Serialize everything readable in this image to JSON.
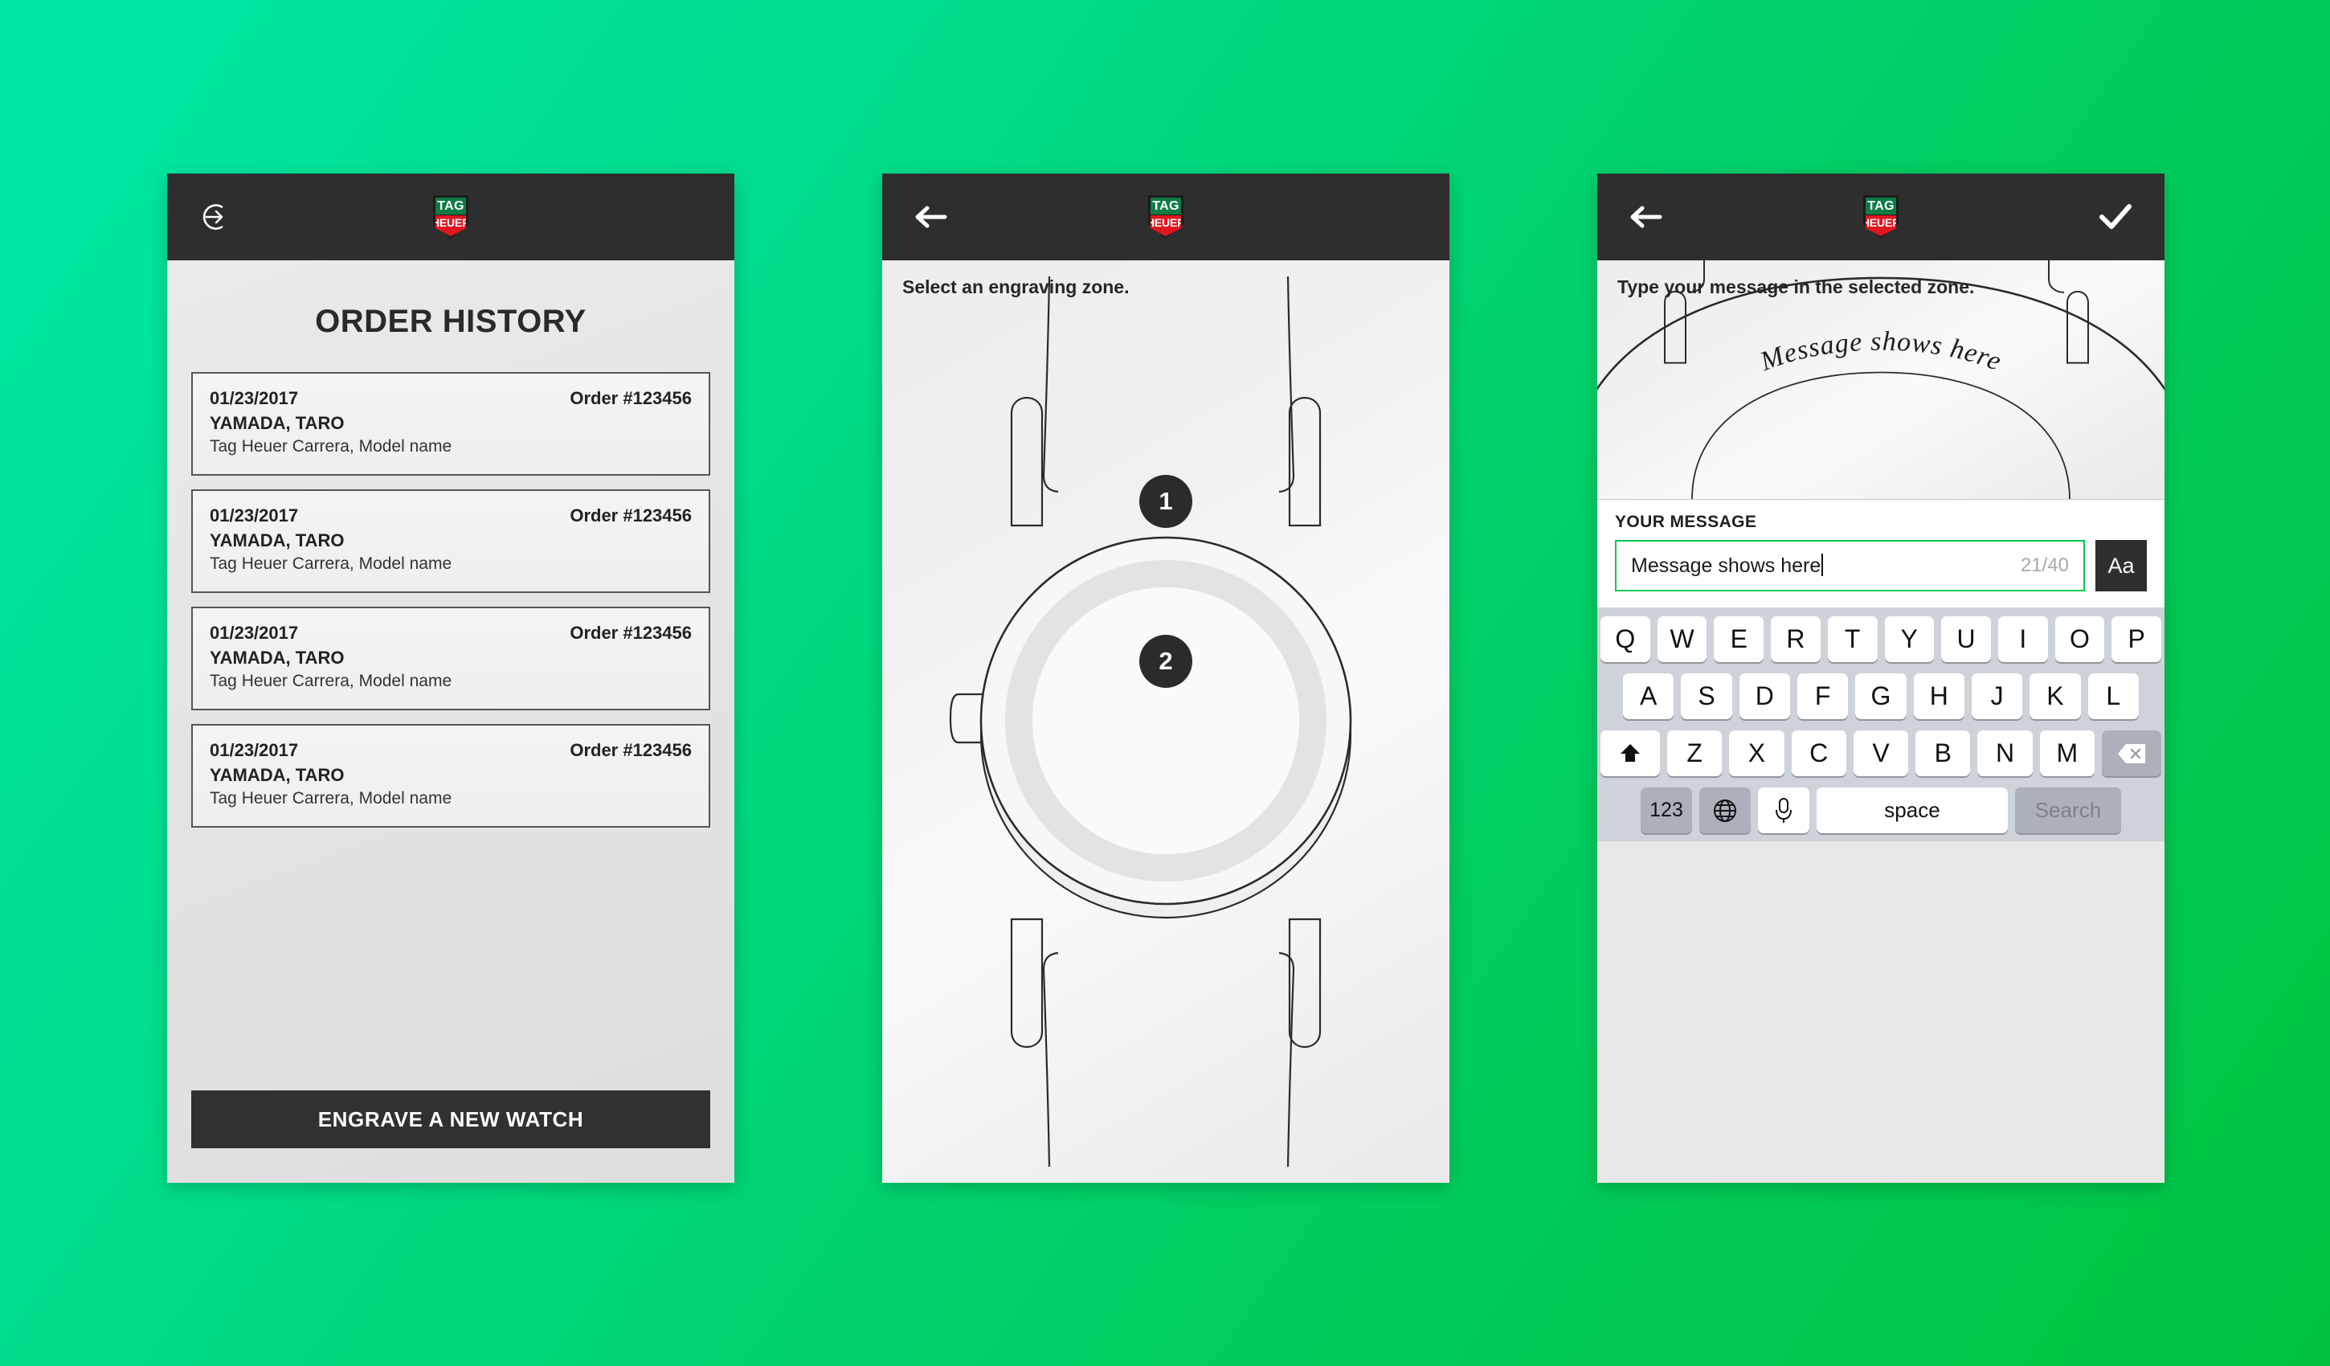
{
  "brand": {
    "logo_top": "TAG",
    "logo_bottom": "HEUER",
    "green": "#0c7c44",
    "red": "#e1161f"
  },
  "background": {
    "from": "#00E8A6",
    "to": "#00C340"
  },
  "screen_1": {
    "name": "order-history",
    "nav": {
      "left_icon": "logout-icon",
      "logo": "tag-heuer-logo"
    },
    "title": "ORDER HISTORY",
    "orders": [
      {
        "date": "01/23/2017",
        "order_no": "Order #123456",
        "customer": "YAMADA, TARO",
        "model": "Tag Heuer Carrera, Model name"
      },
      {
        "date": "01/23/2017",
        "order_no": "Order #123456",
        "customer": "YAMADA, TARO",
        "model": "Tag Heuer Carrera, Model name"
      },
      {
        "date": "01/23/2017",
        "order_no": "Order #123456",
        "customer": "YAMADA, TARO",
        "model": "Tag Heuer Carrera, Model name"
      },
      {
        "date": "01/23/2017",
        "order_no": "Order #123456",
        "customer": "YAMADA, TARO",
        "model": "Tag Heuer Carrera, Model name"
      }
    ],
    "cta": "ENGRAVE A NEW WATCH"
  },
  "screen_2": {
    "name": "select-engraving-zone",
    "nav": {
      "left_icon": "back-arrow-icon",
      "logo": "tag-heuer-logo"
    },
    "hint": "Select an engraving zone.",
    "zones": [
      {
        "id": "1",
        "label": "1"
      },
      {
        "id": "2",
        "label": "2"
      }
    ]
  },
  "screen_3": {
    "name": "type-engraving-message",
    "nav": {
      "left_icon": "back-arrow-icon",
      "logo": "tag-heuer-logo",
      "right_icon": "checkmark-icon"
    },
    "hint": "Type your message in the selected zone.",
    "engraved_preview": "Message shows here",
    "message_label": "YOUR MESSAGE",
    "message_value": "Message shows here",
    "message_placeholder": "Message shows here",
    "char_count": "21/40",
    "font_button": "Aa",
    "accent_color": "#00C853",
    "keyboard": {
      "row1": [
        "Q",
        "W",
        "E",
        "R",
        "T",
        "Y",
        "U",
        "I",
        "O",
        "P"
      ],
      "row2": [
        "A",
        "S",
        "D",
        "F",
        "G",
        "H",
        "J",
        "K",
        "L"
      ],
      "row3": [
        "Z",
        "X",
        "C",
        "V",
        "B",
        "N",
        "M"
      ],
      "shift_icon": "shift-icon",
      "backspace_icon": "backspace-icon",
      "numbers_key": "123",
      "globe_icon": "globe-icon",
      "mic_icon": "microphone-icon",
      "space_key": "space",
      "return_key": "Search"
    }
  }
}
